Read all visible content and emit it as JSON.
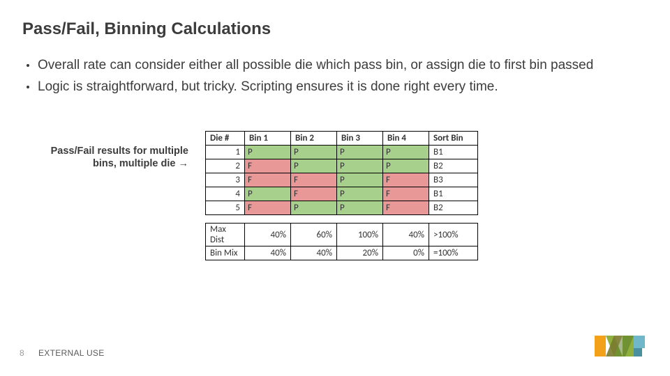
{
  "title": "Pass/Fail, Binning Calculations",
  "bullets": [
    "Overall rate can consider either all possible die which pass bin, or assign die to first bin passed",
    "Logic is straightforward, but tricky.  Scripting ensures it is done right every time."
  ],
  "side_caption": "Pass/Fail results for multiple bins, multiple die →",
  "table": {
    "headers": [
      "Die #",
      "Bin 1",
      "Bin 2",
      "Bin 3",
      "Bin 4",
      "Sort Bin"
    ],
    "rows": [
      {
        "die": "1",
        "cells": [
          "P",
          "P",
          "P",
          "P"
        ],
        "sort": "B1"
      },
      {
        "die": "2",
        "cells": [
          "F",
          "P",
          "P",
          "P"
        ],
        "sort": "B2"
      },
      {
        "die": "3",
        "cells": [
          "F",
          "F",
          "P",
          "F"
        ],
        "sort": "B3"
      },
      {
        "die": "4",
        "cells": [
          "P",
          "F",
          "P",
          "F"
        ],
        "sort": "B1"
      },
      {
        "die": "5",
        "cells": [
          "F",
          "P",
          "P",
          "F"
        ],
        "sort": "B2"
      }
    ],
    "summary": [
      {
        "label": "Max Dist",
        "vals": [
          "40%",
          "60%",
          "100%",
          "40%"
        ],
        "total": ">100%"
      },
      {
        "label": "Bin Mix",
        "vals": [
          "40%",
          "40%",
          "20%",
          "0%"
        ],
        "total": "=100%"
      }
    ]
  },
  "footer": {
    "page": "8",
    "classification": "EXTERNAL USE"
  }
}
